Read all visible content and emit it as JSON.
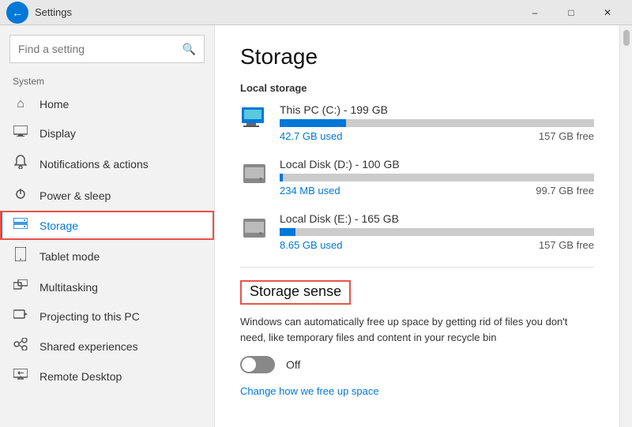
{
  "titlebar": {
    "title": "Settings",
    "back_label": "←",
    "btn_minimize": "–",
    "btn_maximize": "□",
    "btn_close": "✕"
  },
  "sidebar": {
    "search_placeholder": "Find a setting",
    "search_icon": "🔍",
    "section_label": "System",
    "items": [
      {
        "id": "home",
        "label": "Home",
        "icon": "⌂"
      },
      {
        "id": "display",
        "label": "Display",
        "icon": "🖥"
      },
      {
        "id": "notifications",
        "label": "Notifications & actions",
        "icon": "🔔"
      },
      {
        "id": "power",
        "label": "Power & sleep",
        "icon": "⏻"
      },
      {
        "id": "storage",
        "label": "Storage",
        "icon": "–",
        "active": true
      },
      {
        "id": "tablet",
        "label": "Tablet mode",
        "icon": "⬜"
      },
      {
        "id": "multitasking",
        "label": "Multitasking",
        "icon": "⧉"
      },
      {
        "id": "projecting",
        "label": "Projecting to this PC",
        "icon": "⬡"
      },
      {
        "id": "shared",
        "label": "Shared experiences",
        "icon": "✳"
      },
      {
        "id": "remote",
        "label": "Remote Desktop",
        "icon": "⚙"
      }
    ]
  },
  "content": {
    "page_title": "Storage",
    "local_storage_label": "Local storage",
    "drives": [
      {
        "name": "This PC (C:) - 199 GB",
        "used_label": "42.7 GB used",
        "free_label": "157 GB free",
        "used_pct": 21,
        "type": "pc"
      },
      {
        "name": "Local Disk (D:) - 100 GB",
        "used_label": "234 MB used",
        "free_label": "99.7 GB free",
        "used_pct": 1,
        "type": "disk"
      },
      {
        "name": "Local Disk (E:) - 165 GB",
        "used_label": "8.65 GB used",
        "free_label": "157 GB free",
        "used_pct": 5,
        "type": "disk"
      }
    ],
    "sense_title": "Storage sense",
    "sense_desc": "Windows can automatically free up space by getting rid of files you don't need, like temporary files and content in your recycle bin",
    "toggle_label": "Off",
    "change_link": "Change how we free up space"
  },
  "colors": {
    "accent": "#0078d7",
    "red_outline": "#e8534a"
  }
}
